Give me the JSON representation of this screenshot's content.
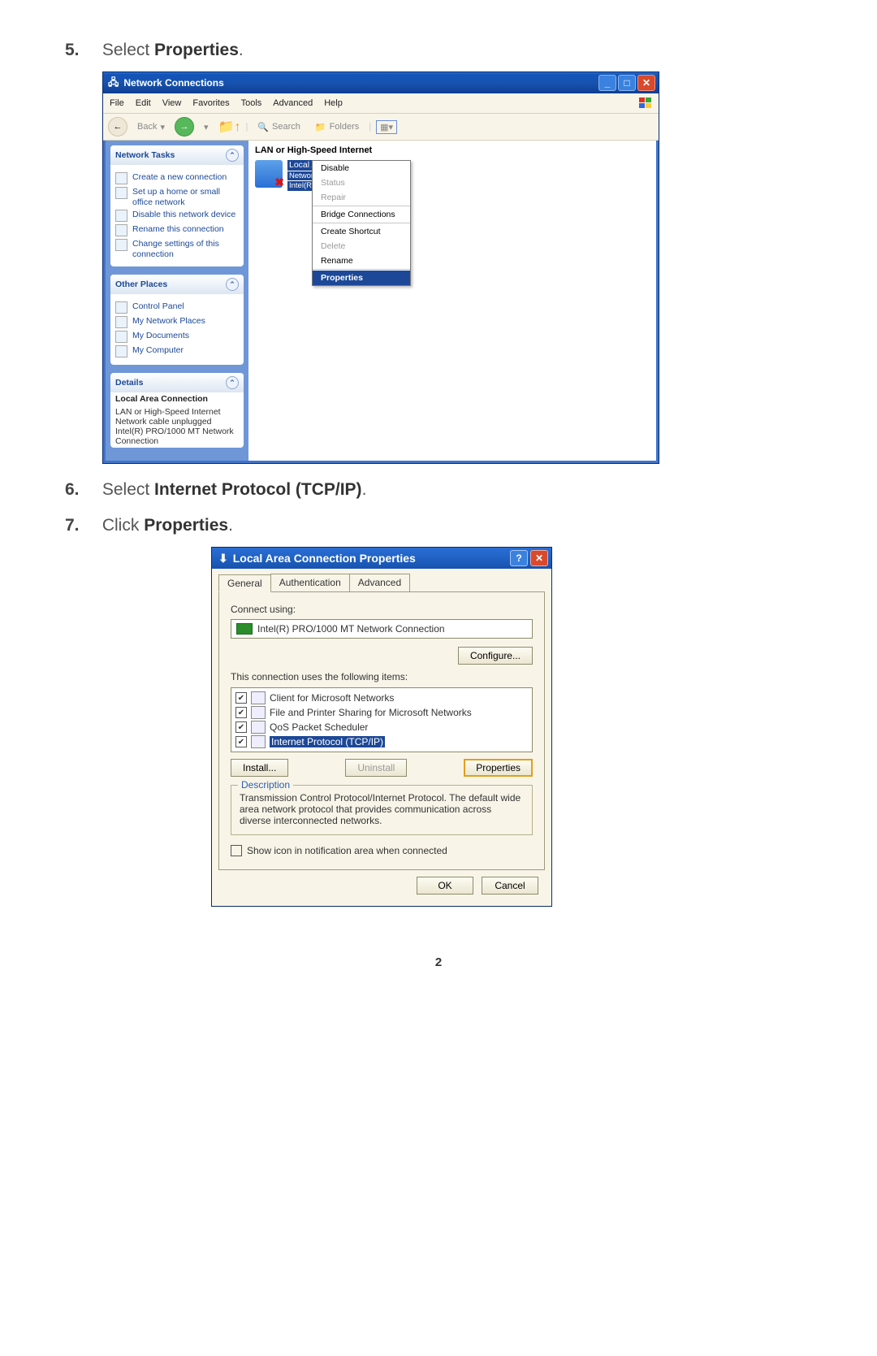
{
  "steps": {
    "s5": {
      "num": "5.",
      "pre": "Select ",
      "bold": "Properties",
      "post": "."
    },
    "s6": {
      "num": "6.",
      "pre": "Select ",
      "bold": "Internet Protocol (TCP/IP)",
      "post": "."
    },
    "s7": {
      "num": "7.",
      "pre": "Click ",
      "bold": "Properties",
      "post": "."
    }
  },
  "nc": {
    "title": "Network Connections",
    "menu": [
      "File",
      "Edit",
      "View",
      "Favorites",
      "Tools",
      "Advanced",
      "Help"
    ],
    "toolbar": {
      "back": "Back",
      "search": "Search",
      "folders": "Folders"
    },
    "panels": {
      "tasks": {
        "title": "Network Tasks",
        "items": [
          "Create a new connection",
          "Set up a home or small office network",
          "Disable this network device",
          "Rename this connection",
          "Change settings of this connection"
        ]
      },
      "other": {
        "title": "Other Places",
        "items": [
          "Control Panel",
          "My Network Places",
          "My Documents",
          "My Computer"
        ]
      },
      "details": {
        "title": "Details",
        "name": "Local Area Connection",
        "line1": "LAN or High-Speed Internet",
        "line2": "Network cable unplugged",
        "line3": "Intel(R) PRO/1000 MT Network Connection"
      }
    },
    "category": "LAN or High-Speed Internet",
    "item": {
      "name": "Local Area Connection",
      "status": "Network cable unplugged",
      "nic": "Intel(R) PRO/1000 MT Net..."
    },
    "context": {
      "disable": "Disable",
      "status": "Status",
      "repair": "Repair",
      "bridge": "Bridge Connections",
      "shortcut": "Create Shortcut",
      "delete": "Delete",
      "rename": "Rename",
      "properties": "Properties"
    }
  },
  "dlg": {
    "title": "Local Area Connection Properties",
    "tabs": [
      "General",
      "Authentication",
      "Advanced"
    ],
    "connect_label": "Connect using:",
    "nic": "Intel(R) PRO/1000 MT Network Connection",
    "configure": "Configure...",
    "uses_label": "This connection uses the following items:",
    "items": [
      {
        "label": "Client for Microsoft Networks",
        "checked": true,
        "sel": false
      },
      {
        "label": "File and Printer Sharing for Microsoft Networks",
        "checked": true,
        "sel": false
      },
      {
        "label": "QoS Packet Scheduler",
        "checked": true,
        "sel": false
      },
      {
        "label": "Internet Protocol (TCP/IP)",
        "checked": true,
        "sel": true
      }
    ],
    "install": "Install...",
    "uninstall": "Uninstall",
    "properties": "Properties",
    "desc_label": "Description",
    "desc": "Transmission Control Protocol/Internet Protocol. The default wide area network protocol that provides communication across diverse interconnected networks.",
    "show_icon": "Show icon in notification area when connected",
    "ok": "OK",
    "cancel": "Cancel"
  },
  "page_number": "2"
}
